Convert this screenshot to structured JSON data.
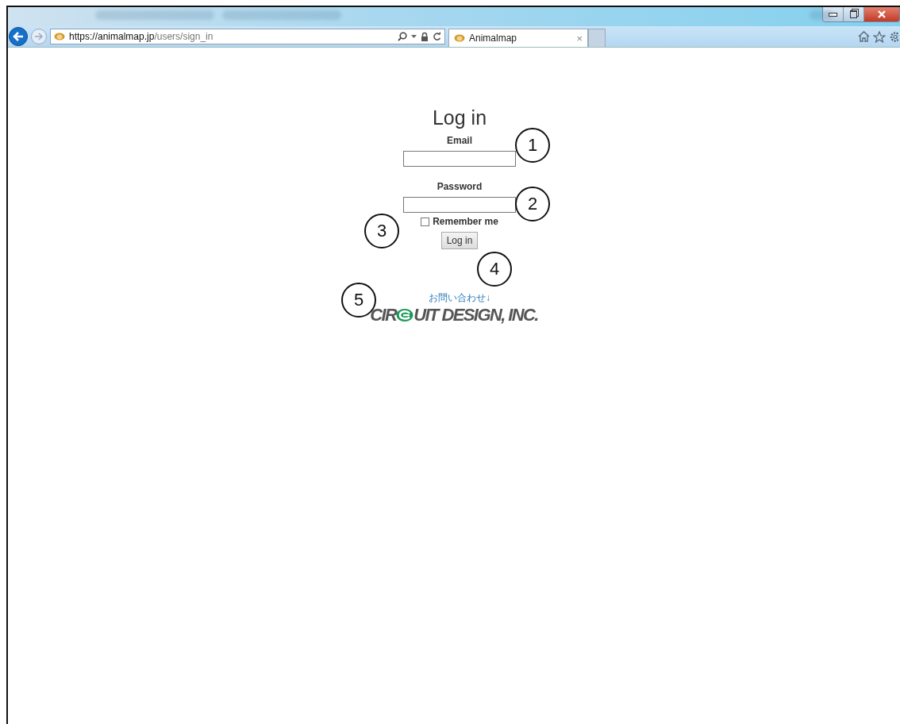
{
  "browser": {
    "address": {
      "host": "https://animalmap.jp",
      "path": "/users/sign_in"
    },
    "tab": {
      "title": "Animalmap",
      "close": "×"
    }
  },
  "login": {
    "title": "Log in",
    "fields": [
      {
        "label": "Email"
      },
      {
        "label": "Password"
      }
    ],
    "remember": {
      "label": "Remember me",
      "checked": false
    },
    "button": "Log in"
  },
  "footer": {
    "link": "お問い合わせ↓",
    "logo": {
      "before": "CIR",
      "after": "UIT DESIGN, INC."
    }
  },
  "callouts": [
    "1",
    "2",
    "3",
    "4",
    "5"
  ]
}
